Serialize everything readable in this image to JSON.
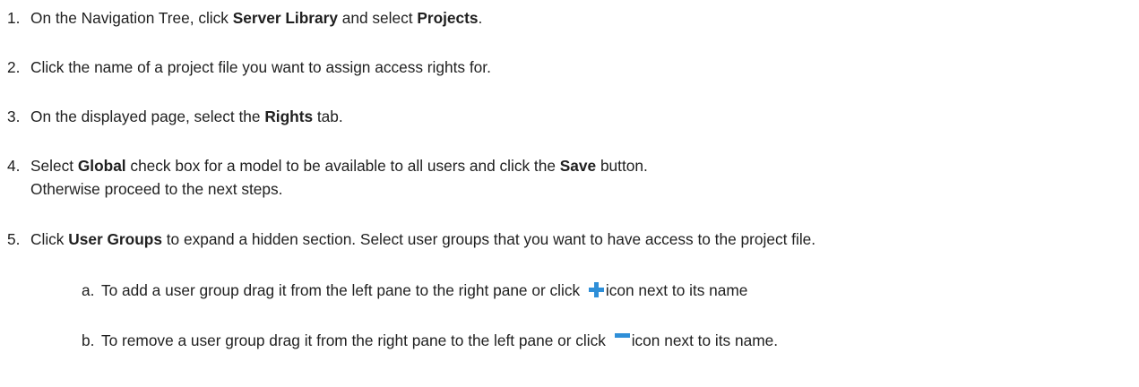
{
  "steps": [
    {
      "num": "1.",
      "parts": [
        "On the Navigation Tree, click ",
        "Server Library",
        " and select ",
        "Projects",
        "."
      ]
    },
    {
      "num": "2.",
      "parts": [
        "Click the name of a project file you want to assign access rights for."
      ]
    },
    {
      "num": "3.",
      "parts": [
        "On the displayed page, select the ",
        "Rights",
        " tab."
      ]
    },
    {
      "num": "4.",
      "parts": [
        "Select ",
        "Global",
        " check box for a model to be available to all users and click the ",
        "Save",
        " button."
      ],
      "continuation": "Otherwise proceed to the next steps."
    },
    {
      "num": "5.",
      "parts": [
        "Click ",
        "User Groups",
        " to expand a hidden section. Select user groups that you want to have access to the project file."
      ]
    }
  ],
  "substeps": [
    {
      "num": "a.",
      "before": "To add a user group drag it from the left pane to the right pane or click ",
      "icon": "plus-icon",
      "after": "icon next to its name"
    },
    {
      "num": "b.",
      "before": "To remove a user group drag it from the right pane to the left  pane or click ",
      "icon": "minus-icon",
      "after": "icon next to its name."
    }
  ],
  "colors": {
    "text": "#1f1f1f",
    "icon_blue": "#2f8fd8"
  }
}
